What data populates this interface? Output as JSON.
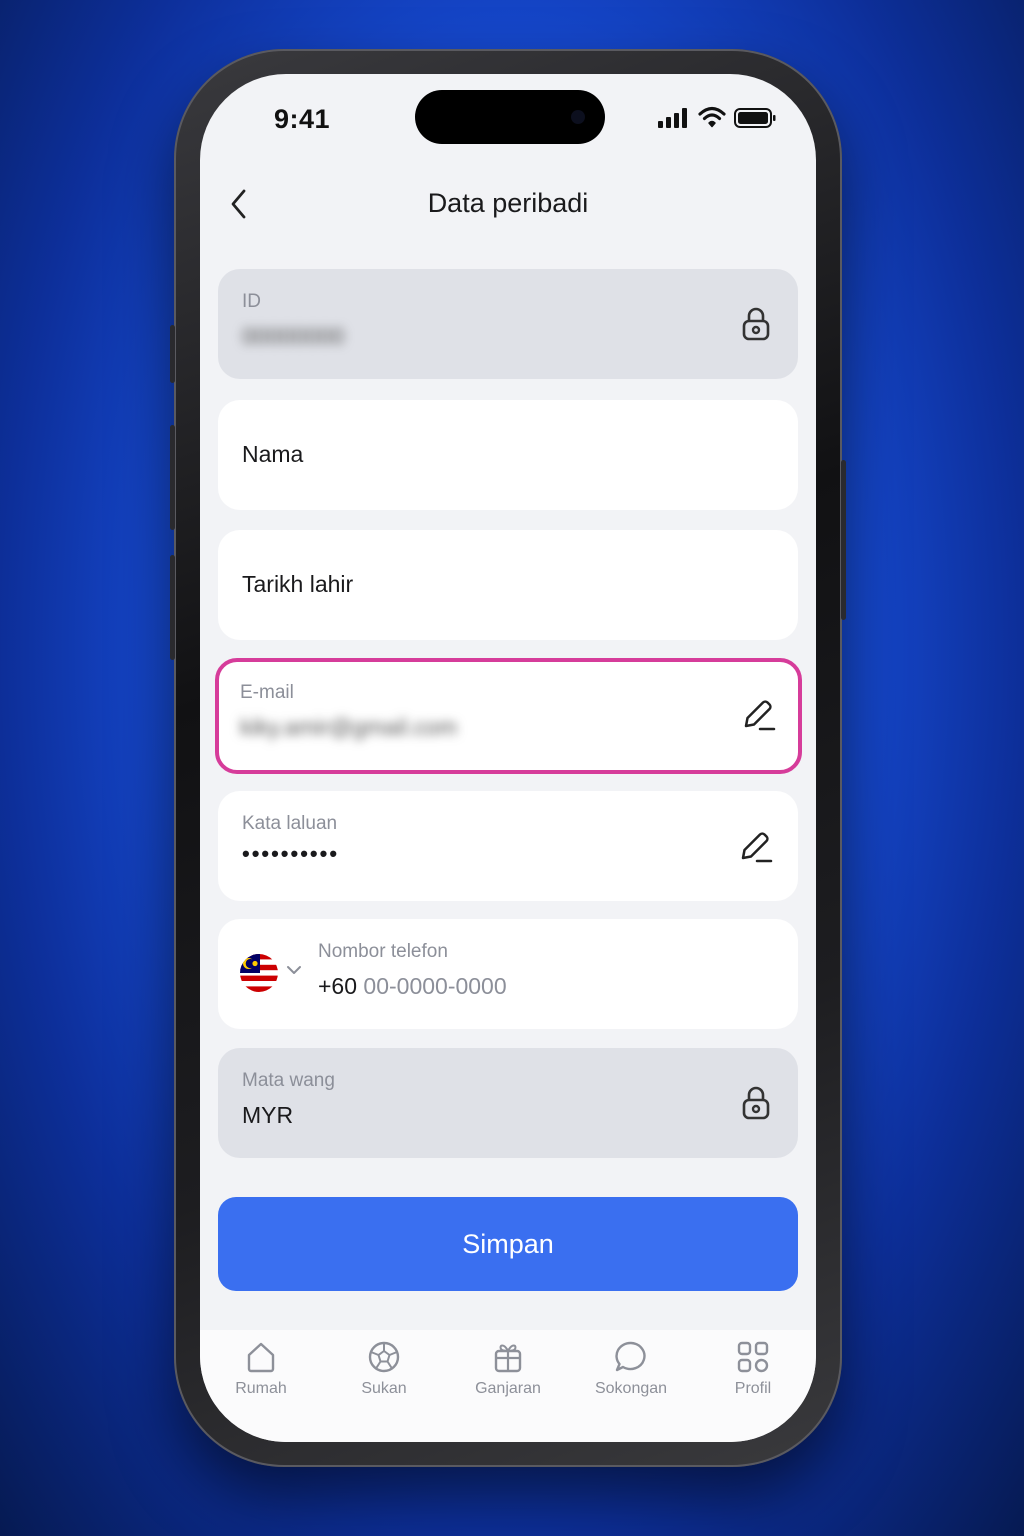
{
  "status_bar": {
    "time": "9:41"
  },
  "header": {
    "title": "Data peribadi",
    "back_icon": "chevron-left-icon"
  },
  "fields": {
    "id": {
      "label": "ID",
      "value": "00000000",
      "locked": true,
      "icon": "lock-icon"
    },
    "nama": {
      "placeholder": "Nama"
    },
    "tarikh_lahir": {
      "placeholder": "Tarikh lahir"
    },
    "email": {
      "label": "E-mail",
      "value": "kiky.amir@gmail.com",
      "icon": "pencil-icon",
      "highlight_color": "#d63c9a"
    },
    "kata_laluan": {
      "label": "Kata laluan",
      "value": "••••••••••",
      "icon": "pencil-icon"
    },
    "telefon": {
      "label": "Nombor telefon",
      "country_code": "+60",
      "placeholder": "00-0000-0000",
      "flag_icon": "malaysia-flag-icon"
    },
    "mata_wang": {
      "label": "Mata wang",
      "value": "MYR",
      "locked": true,
      "icon": "lock-icon"
    }
  },
  "save_button": {
    "label": "Simpan",
    "color": "#3a6ff0"
  },
  "tabbar": {
    "items": [
      {
        "label": "Rumah",
        "icon": "home-icon"
      },
      {
        "label": "Sukan",
        "icon": "soccer-ball-icon"
      },
      {
        "label": "Ganjaran",
        "icon": "gift-icon"
      },
      {
        "label": "Sokongan",
        "icon": "chat-bubble-icon"
      },
      {
        "label": "Profil",
        "icon": "grid-icon"
      }
    ]
  }
}
